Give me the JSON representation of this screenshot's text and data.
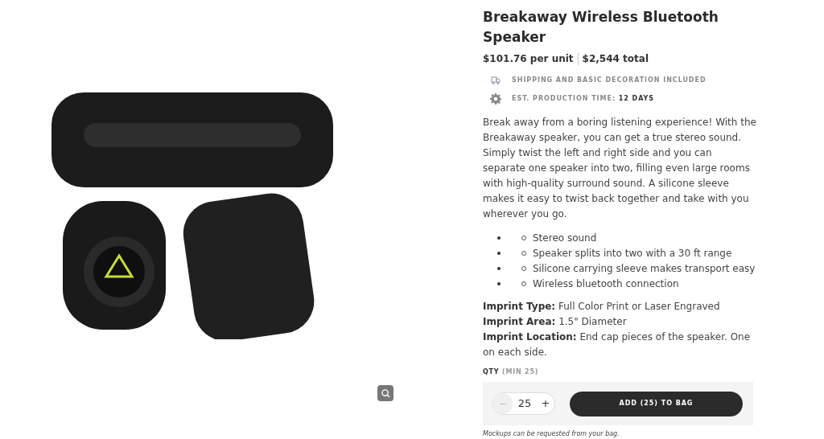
{
  "product": {
    "title": "Breakaway Wireless Bluetooth Speaker",
    "unit_price": "$101.76 per unit",
    "total_price": "$2,544 total",
    "perks": [
      {
        "kind": "truck",
        "label": "SHIPPING AND BASIC DECORATION INCLUDED"
      },
      {
        "kind": "gear",
        "label": "EST. PRODUCTION TIME:",
        "value": "12 DAYS"
      }
    ],
    "description": "Break away from a boring listening experience! With the Breakaway speaker, you can get a true stereo sound. Simply twist the left and right side and you can separate one speaker into two, filling even large rooms with high-quality surround sound. A silicone sleeve makes it easy to twist back together and take with you wherever you go.",
    "features": [
      "Stereo sound",
      "Speaker splits into two with a 30 ft range",
      "Silicone carrying sleeve makes transport easy",
      "Wireless bluetooth connection"
    ],
    "specs": [
      {
        "label": "Imprint Type:",
        "value": "Full Color Print or Laser Engraved"
      },
      {
        "label": "Imprint Area:",
        "value": "1.5\" Diameter"
      },
      {
        "label": "Imprint Location:",
        "value": "End cap pieces of the speaker. One on each side."
      }
    ],
    "qty_label": "QTY",
    "qty_min": "(MIN 25)",
    "stepper": {
      "minus": "−",
      "value": "25",
      "plus": "+",
      "minus_disabled": true
    },
    "add_button": "ADD (25) TO BAG",
    "note": "Mockups can be requested from your bag."
  }
}
